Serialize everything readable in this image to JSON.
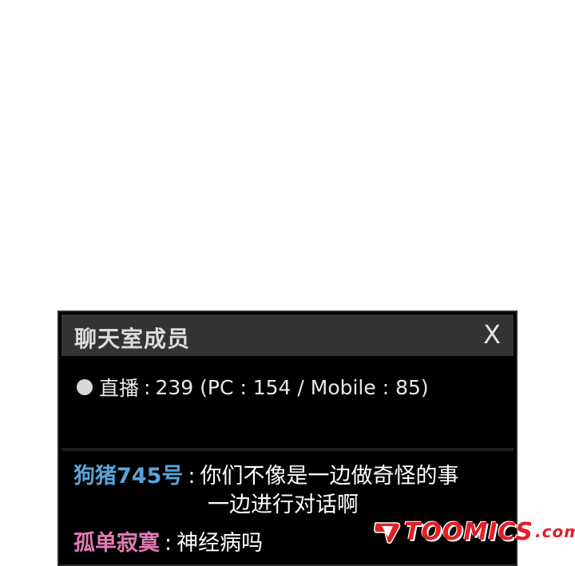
{
  "window": {
    "title": "聊天室成员",
    "close_label": "X"
  },
  "stats": {
    "label": "直播",
    "separator": ":",
    "text": "239 (PC : 154 / Mobile : 85)"
  },
  "messages": [
    {
      "user": "狗猪745号",
      "colon": ":",
      "line1": "你们不像是一边做奇怪的事",
      "line2": "一边进行对话啊"
    },
    {
      "user": "孤单寂寞",
      "colon": ":",
      "line1": "神经病吗"
    }
  ],
  "watermark": {
    "text": "TOOMICS",
    "suffix": ".com"
  },
  "colors": {
    "user_blue": "#5aa3d8",
    "user_pink": "#e07bb6",
    "watermark_red": "#e31e24"
  }
}
